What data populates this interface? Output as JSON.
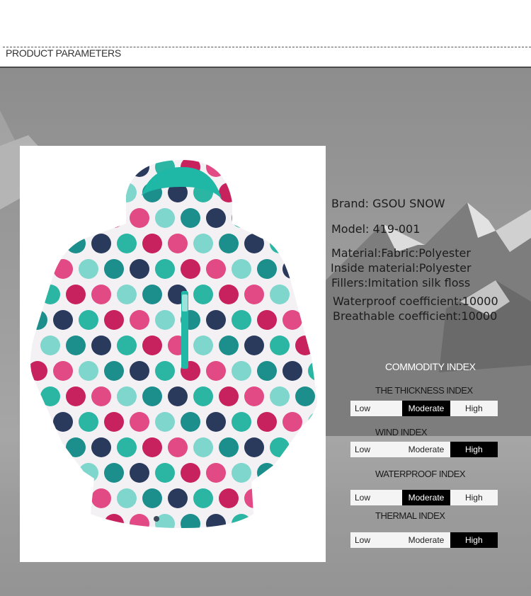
{
  "header": {
    "title": "PRODUCT PARAMETERS"
  },
  "specs": {
    "brand": "Brand:   GSOU SNOW",
    "model": "Model:   419-001",
    "material": "Material:Fabric:Polyester",
    "inside": "Inside material:Polyester",
    "fillers": "Fillers:Imitation silk floss",
    "waterproof": "Waterproof coefficient:10000",
    "breathable": "Breathable coefficient:10000"
  },
  "commodity_index": {
    "title": "COMMODITY INDEX",
    "levels": [
      "Low",
      "Moderate",
      "High"
    ],
    "indices": [
      {
        "name": "THE THICKNESS INDEX",
        "selected": "Moderate"
      },
      {
        "name": "WIND INDEX",
        "selected": "High"
      },
      {
        "name": "WATERPROOF INDEX",
        "selected": "Moderate"
      },
      {
        "name": "THERMAL INDEX",
        "selected": "High"
      }
    ]
  },
  "colors": {
    "accent": "#2bb5a3",
    "magenta": "#c8225e",
    "navy": "#2a3a5c",
    "teal_dark": "#1c8f8c"
  }
}
